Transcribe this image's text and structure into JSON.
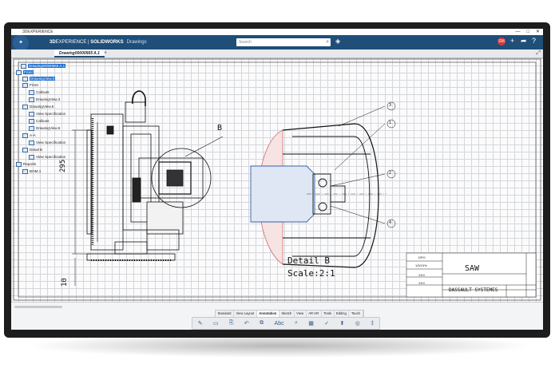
{
  "os": {
    "title": "3DEXPERIENCE",
    "controls": [
      "—",
      "□",
      "✕"
    ]
  },
  "app": {
    "brand_3d": "3D",
    "brand_exp": "EXPERIENCE",
    "brand_sep": " | ",
    "brand_sw": "SOLIDWORKS",
    "app_name": "Drawings",
    "search_placeholder": "Search",
    "avatar": "SM"
  },
  "tabs": [
    {
      "label": "Drawing00000565 A.1"
    }
  ],
  "tree": [
    {
      "label": "Drawing00000565 A.1",
      "selected": true
    },
    {
      "label": "Front",
      "selected": true
    },
    {
      "label": "DrawingView.0",
      "selected": true
    },
    {
      "label": "Front"
    },
    {
      "label": "Callouts"
    },
    {
      "label": "DrawingView.3"
    },
    {
      "label": "DrawingView.5"
    },
    {
      "label": "View Specification"
    },
    {
      "label": "Callouts"
    },
    {
      "label": "DrawingView.6"
    },
    {
      "label": "A-A"
    },
    {
      "label": "View Specification"
    },
    {
      "label": "Detail B"
    },
    {
      "label": "View Specification"
    },
    {
      "label": "Reports"
    },
    {
      "label": "BOM.1"
    }
  ],
  "drawing": {
    "callout_b": "B",
    "dim_295": "295",
    "dim_10": "10",
    "balloons": [
      "3",
      "1",
      "2",
      "4"
    ],
    "detail_title": "Detail B",
    "detail_scale": "Scale:2:1"
  },
  "title_block": {
    "part_name": "SAW",
    "company": "DASSAULT SYSTEMES",
    "cells": [
      "DPO",
      "1/5/19%",
      "XXX",
      "XXX"
    ]
  },
  "section_tabs": [
    "Standard",
    "View Layout",
    "Annotation",
    "Sketch",
    "View",
    "AR-VR",
    "Tools",
    "Editing",
    "Touch"
  ],
  "section_active": "Annotation",
  "action_icons": [
    "✎",
    "▭",
    "⎘",
    "↶",
    "⧉",
    "Abc",
    "⌕",
    "▦",
    "✓",
    "⬆",
    "◎",
    "‡"
  ]
}
